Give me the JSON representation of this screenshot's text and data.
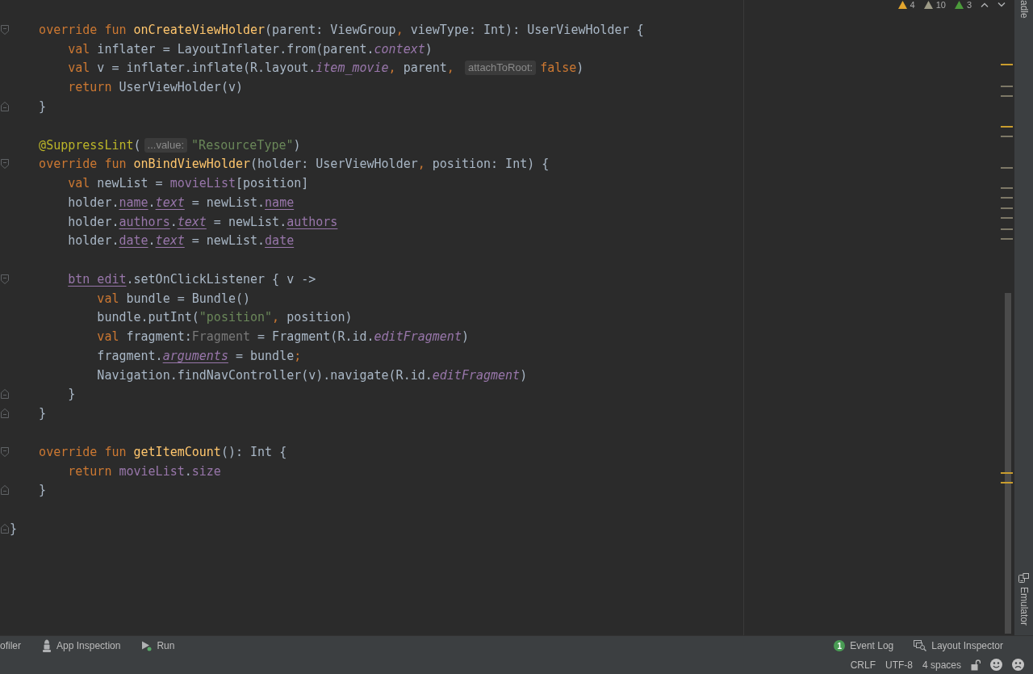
{
  "editor": {
    "lines": [
      {
        "kind": "body",
        "children": [
          {
            "kind": "blank"
          },
          {
            "kind": "open",
            "tokens": [
              {
                "text": "override fun ",
                "kind": "keyword"
              },
              {
                "text": "onCreateViewHolder",
                "kind": "declaration"
              },
              {
                "text": "(parent: ViewGroup",
                "kind": "plain"
              },
              {
                "text": ",",
                "kind": "punctuation"
              },
              {
                "text": " viewType: Int): UserViewHolder {",
                "kind": "plain"
              }
            ],
            "children": [
              {
                "kind": "line",
                "tokens": [
                  {
                    "text": "val ",
                    "kind": "keyword"
                  },
                  {
                    "text": "inflater = LayoutInflater.from(parent.",
                    "kind": "plain"
                  },
                  {
                    "text": "context",
                    "kind": "static"
                  },
                  {
                    "text": ")",
                    "kind": "plain"
                  }
                ]
              },
              {
                "kind": "line",
                "tokens": [
                  {
                    "text": "val ",
                    "kind": "keyword"
                  },
                  {
                    "text": "v = inflater.inflate(R.layout.",
                    "kind": "plain"
                  },
                  {
                    "text": "item_movie",
                    "kind": "static"
                  },
                  {
                    "text": ",",
                    "kind": "punctuation"
                  },
                  {
                    "text": " parent",
                    "kind": "plain"
                  },
                  {
                    "text": ", ",
                    "kind": "punctuation"
                  },
                  {
                    "text": "attachToRoot:",
                    "kind": "hint"
                  },
                  {
                    "text": "false",
                    "kind": "keyword"
                  },
                  {
                    "text": ")",
                    "kind": "plain"
                  }
                ]
              },
              {
                "kind": "line",
                "tokens": [
                  {
                    "text": "return ",
                    "kind": "keyword"
                  },
                  {
                    "text": "UserViewHolder(v)",
                    "kind": "plain"
                  }
                ]
              }
            ]
          },
          {
            "kind": "close",
            "tokens": [
              {
                "text": "}",
                "kind": "plain"
              }
            ]
          },
          {
            "kind": "blank"
          },
          {
            "kind": "line",
            "tokens": [
              {
                "text": "@SuppressLint",
                "kind": "annotation"
              },
              {
                "text": "(",
                "kind": "plain"
              },
              {
                "text": "...value:",
                "kind": "hint"
              },
              {
                "text": "\"ResourceType\"",
                "kind": "string"
              },
              {
                "text": ")",
                "kind": "plain"
              }
            ]
          },
          {
            "kind": "open",
            "tokens": [
              {
                "text": "override fun ",
                "kind": "keyword"
              },
              {
                "text": "onBindViewHolder",
                "kind": "declaration"
              },
              {
                "text": "(holder: UserViewHolder",
                "kind": "plain"
              },
              {
                "text": ",",
                "kind": "punctuation"
              },
              {
                "text": " position: Int) {",
                "kind": "plain"
              }
            ],
            "children": [
              {
                "kind": "line",
                "tokens": [
                  {
                    "text": "val ",
                    "kind": "keyword"
                  },
                  {
                    "text": "newList = ",
                    "kind": "plain"
                  },
                  {
                    "text": "movieList",
                    "kind": "property"
                  },
                  {
                    "text": "[position]",
                    "kind": "plain"
                  }
                ]
              },
              {
                "kind": "line",
                "tokens": [
                  {
                    "text": "holder.",
                    "kind": "plain"
                  },
                  {
                    "text": "name",
                    "kind": "synthetic"
                  },
                  {
                    "text": ".",
                    "kind": "plain"
                  },
                  {
                    "text": "text",
                    "kind": "accessor"
                  },
                  {
                    "text": " = newList.",
                    "kind": "plain"
                  },
                  {
                    "text": "name",
                    "kind": "synthetic"
                  }
                ]
              },
              {
                "kind": "line",
                "tokens": [
                  {
                    "text": "holder.",
                    "kind": "plain"
                  },
                  {
                    "text": "authors",
                    "kind": "synthetic"
                  },
                  {
                    "text": ".",
                    "kind": "plain"
                  },
                  {
                    "text": "text",
                    "kind": "accessor"
                  },
                  {
                    "text": " = newList.",
                    "kind": "plain"
                  },
                  {
                    "text": "authors",
                    "kind": "synthetic"
                  }
                ]
              },
              {
                "kind": "line",
                "tokens": [
                  {
                    "text": "holder.",
                    "kind": "plain"
                  },
                  {
                    "text": "date",
                    "kind": "synthetic"
                  },
                  {
                    "text": ".",
                    "kind": "plain"
                  },
                  {
                    "text": "text",
                    "kind": "accessor"
                  },
                  {
                    "text": " = newList.",
                    "kind": "plain"
                  },
                  {
                    "text": "date",
                    "kind": "synthetic"
                  }
                ]
              },
              {
                "kind": "blank"
              },
              {
                "kind": "open",
                "tokens": [
                  {
                    "text": "btn_edit",
                    "kind": "synthetic"
                  },
                  {
                    "text": ".setOnClickListener { v ->",
                    "kind": "plain"
                  }
                ],
                "children": [
                  {
                    "kind": "line",
                    "tokens": [
                      {
                        "text": "val ",
                        "kind": "keyword"
                      },
                      {
                        "text": "bundle = Bundle()",
                        "kind": "plain"
                      }
                    ]
                  },
                  {
                    "kind": "line",
                    "tokens": [
                      {
                        "text": "bundle.putInt(",
                        "kind": "plain"
                      },
                      {
                        "text": "\"position\"",
                        "kind": "string"
                      },
                      {
                        "text": ",",
                        "kind": "punctuation"
                      },
                      {
                        "text": " position)",
                        "kind": "plain"
                      }
                    ]
                  },
                  {
                    "kind": "line",
                    "tokens": [
                      {
                        "text": "val ",
                        "kind": "keyword"
                      },
                      {
                        "text": "fragment:",
                        "kind": "plain"
                      },
                      {
                        "text": "Fragment",
                        "kind": "redundant"
                      },
                      {
                        "text": " = Fragment(R.id.",
                        "kind": "plain"
                      },
                      {
                        "text": "editFragment",
                        "kind": "static"
                      },
                      {
                        "text": ")",
                        "kind": "plain"
                      }
                    ]
                  },
                  {
                    "kind": "line",
                    "tokens": [
                      {
                        "text": "fragment.",
                        "kind": "plain"
                      },
                      {
                        "text": "arguments",
                        "kind": "accessor"
                      },
                      {
                        "text": " = bundle",
                        "kind": "plain"
                      },
                      {
                        "text": ";",
                        "kind": "punctuation"
                      }
                    ]
                  },
                  {
                    "kind": "line",
                    "tokens": [
                      {
                        "text": "Navigation.findNavController(v).navigate(R.id.",
                        "kind": "plain"
                      },
                      {
                        "text": "editFragment",
                        "kind": "static"
                      },
                      {
                        "text": ")",
                        "kind": "plain"
                      }
                    ]
                  }
                ]
              },
              {
                "kind": "close",
                "tokens": [
                  {
                    "text": "}",
                    "kind": "plain"
                  }
                ]
              }
            ]
          },
          {
            "kind": "close",
            "tokens": [
              {
                "text": "}",
                "kind": "plain"
              }
            ]
          },
          {
            "kind": "blank"
          },
          {
            "kind": "open",
            "tokens": [
              {
                "text": "override fun ",
                "kind": "keyword"
              },
              {
                "text": "getItemCount",
                "kind": "declaration"
              },
              {
                "text": "(): Int {",
                "kind": "plain"
              }
            ],
            "children": [
              {
                "kind": "line",
                "tokens": [
                  {
                    "text": "return ",
                    "kind": "keyword"
                  },
                  {
                    "text": "movieList",
                    "kind": "property"
                  },
                  {
                    "text": ".",
                    "kind": "plain"
                  },
                  {
                    "text": "size",
                    "kind": "property"
                  }
                ]
              }
            ]
          },
          {
            "kind": "close",
            "tokens": [
              {
                "text": "}",
                "kind": "plain"
              }
            ]
          },
          {
            "kind": "blank"
          }
        ]
      },
      {
        "kind": "close",
        "tokens": [
          {
            "text": "}",
            "kind": "plain"
          }
        ]
      }
    ]
  },
  "inspections": [
    {
      "count": "4",
      "color": "#e2a52e"
    },
    {
      "count": "10",
      "color": "#9d9a86"
    },
    {
      "count": "3",
      "color": "#4c9a3b"
    }
  ],
  "error_stripe": [
    {
      "kind": "warning"
    },
    {
      "kind": "weak"
    },
    {
      "kind": "weak"
    },
    {
      "kind": "warning"
    },
    {
      "kind": "weak"
    },
    {
      "kind": "weak"
    },
    {
      "kind": "weak"
    },
    {
      "kind": "weak"
    },
    {
      "kind": "weak"
    },
    {
      "kind": "weak"
    },
    {
      "kind": "weak"
    },
    {
      "kind": "weak"
    },
    {
      "kind": "warning"
    },
    {
      "kind": "warning"
    }
  ],
  "right_tool_strip": {
    "top_label": "adle",
    "bottom_label": "Emulator"
  },
  "tool_window_bar": {
    "left": [
      {
        "label": "ofiler"
      },
      {
        "label": "App Inspection"
      },
      {
        "label": "Run"
      }
    ],
    "right": [
      {
        "label": "Event Log",
        "badge": "1"
      },
      {
        "label": "Layout Inspector"
      }
    ]
  },
  "status_bar": {
    "items": [
      "CRLF",
      "UTF-8",
      "4 spaces"
    ]
  }
}
